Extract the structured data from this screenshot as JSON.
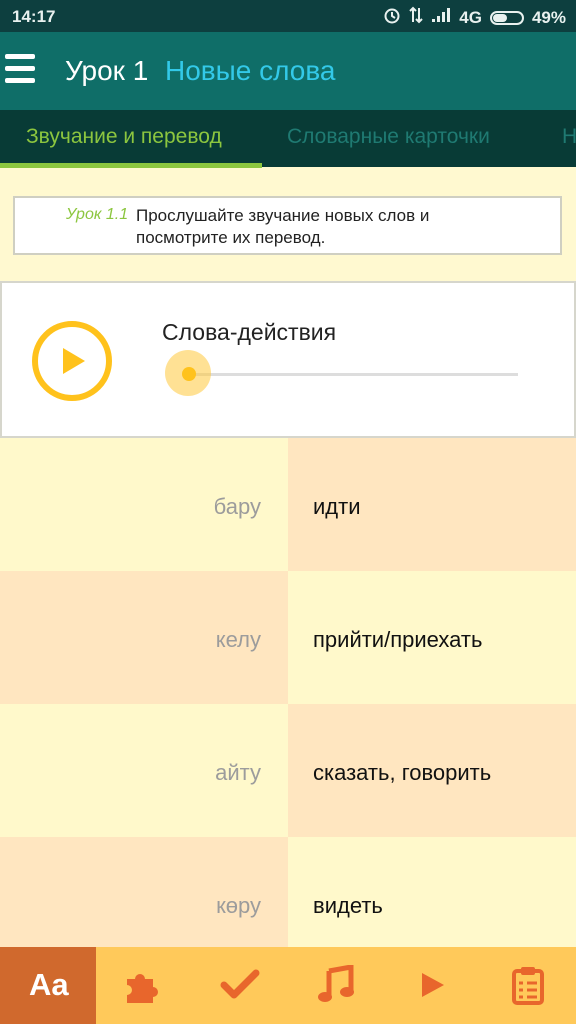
{
  "status_bar": {
    "time": "14:17",
    "network": "4G",
    "battery": "49%"
  },
  "header": {
    "lesson": "Урок 1",
    "section": "Новые слова"
  },
  "tabs": [
    {
      "label": "Звучание и перевод",
      "active": true
    },
    {
      "label": "Словарные карточки",
      "active": false
    },
    {
      "label": "Н",
      "active": false
    }
  ],
  "instruction": {
    "number": "Урок 1.1",
    "text": "Прослушайте звучание новых слов и посмотрите их перевод."
  },
  "player": {
    "title": "Слова-действия",
    "progress": 0
  },
  "words": [
    {
      "kazakh": "бару",
      "russian": "идти"
    },
    {
      "kazakh": "келу",
      "russian": "прийти/приехать"
    },
    {
      "kazakh": "айту",
      "russian": "сказать, говорить"
    },
    {
      "kazakh": "көру",
      "russian": "видеть"
    }
  ],
  "bottom_nav": {
    "items": [
      {
        "label": "Aa",
        "icon": "alphabet-icon",
        "active": true
      },
      {
        "icon": "puzzle-icon"
      },
      {
        "icon": "checkmark-icon"
      },
      {
        "icon": "music-note-icon"
      },
      {
        "icon": "play-icon"
      },
      {
        "icon": "clipboard-icon"
      }
    ]
  },
  "colors": {
    "status_bar": "#0d3f3f",
    "app_bar": "#0f6e68",
    "tab_bar": "#083b36",
    "accent_green": "#8cc63f",
    "title_blue": "#33c9e8",
    "player_yellow": "#ffc21c",
    "bottom_nav": "#ffc95a",
    "bottom_nav_active": "#d0692d"
  }
}
